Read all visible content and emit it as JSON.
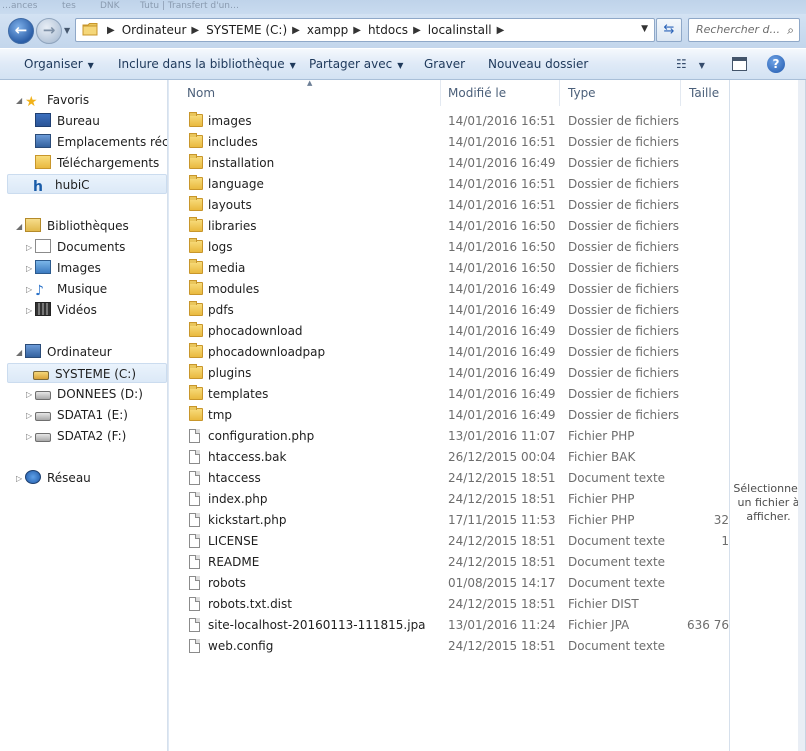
{
  "top_strip": {
    "ghost_texts": [
      "…ances",
      "tes",
      "DNK",
      "Tutu | Transfert d'un…"
    ]
  },
  "navigation": {
    "back_glyph": "←",
    "forward_glyph": "→",
    "breadcrumbs": [
      "Ordinateur",
      "SYSTEME (C:)",
      "xampp",
      "htdocs",
      "localinstall"
    ],
    "breadcrumb_separator": "▶",
    "refresh_glyph": "⇆",
    "search_placeholder": "Rechercher d...",
    "search_icon_glyph": "⌕"
  },
  "command_bar": {
    "organize": "Organiser",
    "include_library": "Inclure dans la bibliothèque",
    "share_with": "Partager avec",
    "burn": "Graver",
    "new_folder": "Nouveau dossier",
    "help_glyph": "?"
  },
  "nav_pane": {
    "favorites": {
      "label": "Favoris",
      "items": [
        "Bureau",
        "Emplacements récents",
        "Téléchargements",
        "hubiC"
      ]
    },
    "libraries": {
      "label": "Bibliothèques",
      "items": [
        "Documents",
        "Images",
        "Musique",
        "Vidéos"
      ]
    },
    "computer": {
      "label": "Ordinateur",
      "items": [
        "SYSTEME (C:)",
        "DONNEES (D:)",
        "SDATA1 (E:)",
        "SDATA2 (F:)"
      ]
    },
    "network": {
      "label": "Réseau"
    }
  },
  "columns": {
    "name": "Nom",
    "modified": "Modifié le",
    "type": "Type",
    "size": "Taille"
  },
  "files": [
    {
      "name": "images",
      "modified": "14/01/2016 16:51",
      "type": "Dossier de fichiers",
      "size": "",
      "kind": "folder"
    },
    {
      "name": "includes",
      "modified": "14/01/2016 16:51",
      "type": "Dossier de fichiers",
      "size": "",
      "kind": "folder"
    },
    {
      "name": "installation",
      "modified": "14/01/2016 16:49",
      "type": "Dossier de fichiers",
      "size": "",
      "kind": "folder"
    },
    {
      "name": "language",
      "modified": "14/01/2016 16:51",
      "type": "Dossier de fichiers",
      "size": "",
      "kind": "folder"
    },
    {
      "name": "layouts",
      "modified": "14/01/2016 16:51",
      "type": "Dossier de fichiers",
      "size": "",
      "kind": "folder"
    },
    {
      "name": "libraries",
      "modified": "14/01/2016 16:50",
      "type": "Dossier de fichiers",
      "size": "",
      "kind": "folder"
    },
    {
      "name": "logs",
      "modified": "14/01/2016 16:50",
      "type": "Dossier de fichiers",
      "size": "",
      "kind": "folder"
    },
    {
      "name": "media",
      "modified": "14/01/2016 16:50",
      "type": "Dossier de fichiers",
      "size": "",
      "kind": "folder"
    },
    {
      "name": "modules",
      "modified": "14/01/2016 16:49",
      "type": "Dossier de fichiers",
      "size": "",
      "kind": "folder"
    },
    {
      "name": "pdfs",
      "modified": "14/01/2016 16:49",
      "type": "Dossier de fichiers",
      "size": "",
      "kind": "folder"
    },
    {
      "name": "phocadownload",
      "modified": "14/01/2016 16:49",
      "type": "Dossier de fichiers",
      "size": "",
      "kind": "folder"
    },
    {
      "name": "phocadownloadpap",
      "modified": "14/01/2016 16:49",
      "type": "Dossier de fichiers",
      "size": "",
      "kind": "folder"
    },
    {
      "name": "plugins",
      "modified": "14/01/2016 16:49",
      "type": "Dossier de fichiers",
      "size": "",
      "kind": "folder"
    },
    {
      "name": "templates",
      "modified": "14/01/2016 16:49",
      "type": "Dossier de fichiers",
      "size": "",
      "kind": "folder"
    },
    {
      "name": "tmp",
      "modified": "14/01/2016 16:49",
      "type": "Dossier de fichiers",
      "size": "",
      "kind": "folder"
    },
    {
      "name": "configuration.php",
      "modified": "13/01/2016 11:07",
      "type": "Fichier PHP",
      "size": "",
      "kind": "file"
    },
    {
      "name": "htaccess.bak",
      "modified": "26/12/2015 00:04",
      "type": "Fichier BAK",
      "size": "",
      "kind": "file"
    },
    {
      "name": "htaccess",
      "modified": "24/12/2015 18:51",
      "type": "Document texte",
      "size": "",
      "kind": "file"
    },
    {
      "name": "index.php",
      "modified": "24/12/2015 18:51",
      "type": "Fichier PHP",
      "size": "",
      "kind": "file"
    },
    {
      "name": "kickstart.php",
      "modified": "17/11/2015 11:53",
      "type": "Fichier PHP",
      "size": "32",
      "kind": "file"
    },
    {
      "name": "LICENSE",
      "modified": "24/12/2015 18:51",
      "type": "Document texte",
      "size": "1",
      "kind": "file"
    },
    {
      "name": "README",
      "modified": "24/12/2015 18:51",
      "type": "Document texte",
      "size": "",
      "kind": "file"
    },
    {
      "name": "robots",
      "modified": "01/08/2015 14:17",
      "type": "Document texte",
      "size": "",
      "kind": "file"
    },
    {
      "name": "robots.txt.dist",
      "modified": "24/12/2015 18:51",
      "type": "Fichier DIST",
      "size": "",
      "kind": "file"
    },
    {
      "name": "site-localhost-20160113-111815.jpa",
      "modified": "13/01/2016 11:24",
      "type": "Fichier JPA",
      "size": "636 76",
      "kind": "file"
    },
    {
      "name": "web.config",
      "modified": "24/12/2015 18:51",
      "type": "Document texte",
      "size": "",
      "kind": "file"
    }
  ],
  "preview_pane": {
    "message_line1": "Sélectionnez",
    "message_line2": "un fichier à",
    "message_line3": "afficher."
  }
}
